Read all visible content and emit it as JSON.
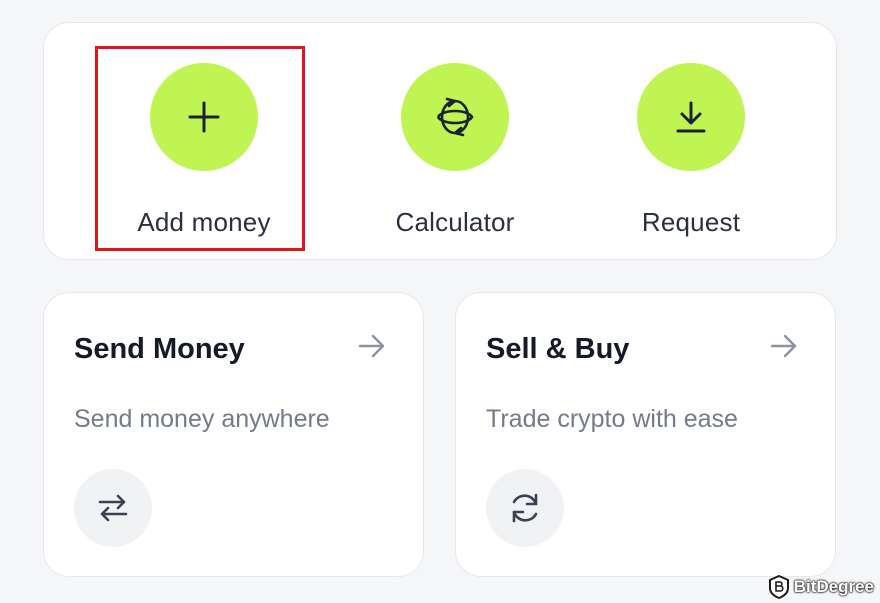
{
  "quick_actions": [
    {
      "label": "Add money",
      "icon": "plus-icon"
    },
    {
      "label": "Calculator",
      "icon": "currency-exchange-icon"
    },
    {
      "label": "Request",
      "icon": "download-icon"
    }
  ],
  "tiles": [
    {
      "title": "Send Money",
      "description": "Send money anywhere",
      "icon": "swap-arrows-icon"
    },
    {
      "title": "Sell & Buy",
      "description": "Trade crypto with ease",
      "icon": "refresh-icon"
    }
  ],
  "watermark": {
    "text": "BitDegree"
  },
  "colors": {
    "accent": "#bff452",
    "highlight": "#e0161b",
    "background": "#f5f6f8",
    "card": "#ffffff"
  }
}
